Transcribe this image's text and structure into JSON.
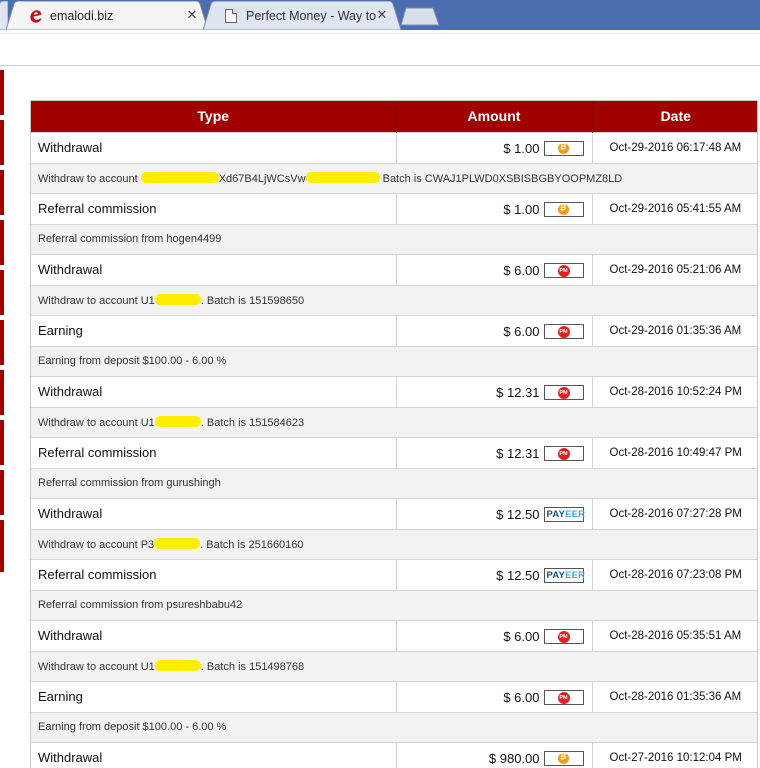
{
  "browser": {
    "tabs": [
      {
        "title": "emalodi.biz",
        "active": true,
        "icon": "emalodi-e-icon"
      },
      {
        "title": "Perfect Money - Way to i",
        "active": false,
        "icon": "page-icon"
      }
    ],
    "close_glyph": "✕"
  },
  "table": {
    "headers": {
      "type": "Type",
      "amount": "Amount",
      "date": "Date"
    },
    "rows": [
      {
        "type": "Withdrawal",
        "amount": "$ 1.00",
        "processor": "bitcoin",
        "date": "Oct-29-2016 06:17:48 AM",
        "detail": [
          "Withdraw to account ",
          "",
          "Xd67B4LjWCsVw",
          "",
          " Batch is CWAJ1PLWD0XSBISBGBYOOPMZ8LD"
        ]
      },
      {
        "type": "Referral commission",
        "amount": "$ 1.00",
        "processor": "bitcoin",
        "date": "Oct-29-2016 05:41:55 AM",
        "detail": [
          "Referral commission from hogen4499",
          "",
          "",
          "",
          ""
        ]
      },
      {
        "type": "Withdrawal",
        "amount": "$ 6.00",
        "processor": "perfectmoney",
        "date": "Oct-29-2016 05:21:06 AM",
        "detail": [
          "Withdraw to account U1",
          "",
          ". Batch is 151598650",
          "",
          ""
        ]
      },
      {
        "type": "Earning",
        "amount": "$ 6.00",
        "processor": "perfectmoney",
        "date": "Oct-29-2016 01:35:36 AM",
        "detail": [
          "Earning from deposit $100.00 - 6.00 %",
          "",
          "",
          "",
          ""
        ]
      },
      {
        "type": "Withdrawal",
        "amount": "$ 12.31",
        "processor": "perfectmoney",
        "date": "Oct-28-2016 10:52:24 PM",
        "detail": [
          "Withdraw to account U1",
          "",
          ". Batch is 151584623",
          "",
          ""
        ]
      },
      {
        "type": "Referral commission",
        "amount": "$ 12.31",
        "processor": "perfectmoney",
        "date": "Oct-28-2016 10:49:47 PM",
        "detail": [
          "Referral commission from gurushingh",
          "",
          "",
          "",
          ""
        ]
      },
      {
        "type": "Withdrawal",
        "amount": "$ 12.50",
        "processor": "payeer",
        "date": "Oct-28-2016 07:27:28 PM",
        "detail": [
          "Withdraw to account P3",
          "",
          ". Batch is 251660160",
          "",
          ""
        ]
      },
      {
        "type": "Referral commission",
        "amount": "$ 12.50",
        "processor": "payeer",
        "date": "Oct-28-2016 07:23:08 PM",
        "detail": [
          "Referral commission from psureshbabu42",
          "",
          "",
          "",
          ""
        ]
      },
      {
        "type": "Withdrawal",
        "amount": "$ 6.00",
        "processor": "perfectmoney",
        "date": "Oct-28-2016 05:35:51 AM",
        "detail": [
          "Withdraw to account U1",
          "",
          ". Batch is 151498768",
          "",
          ""
        ]
      },
      {
        "type": "Earning",
        "amount": "$ 6.00",
        "processor": "perfectmoney",
        "date": "Oct-28-2016 01:35:36 AM",
        "detail": [
          "Earning from deposit $100.00 - 6.00 %",
          "",
          "",
          "",
          ""
        ]
      },
      {
        "type": "Withdrawal",
        "amount": "$ 980.00",
        "processor": "bitcoin",
        "date": "Oct-27-2016 10:12:04 PM",
        "detail": null
      }
    ]
  },
  "processor_badges": {
    "perfectmoney": "PM",
    "payeer_part1": "PAY",
    "payeer_part2": "EER"
  },
  "colors": {
    "header_bg": "#a00000",
    "tabstrip_bg": "#4b6eaf",
    "bitcoin": "#f39c12",
    "perfectmoney": "#e02020",
    "highlighter": "#ffee00"
  }
}
